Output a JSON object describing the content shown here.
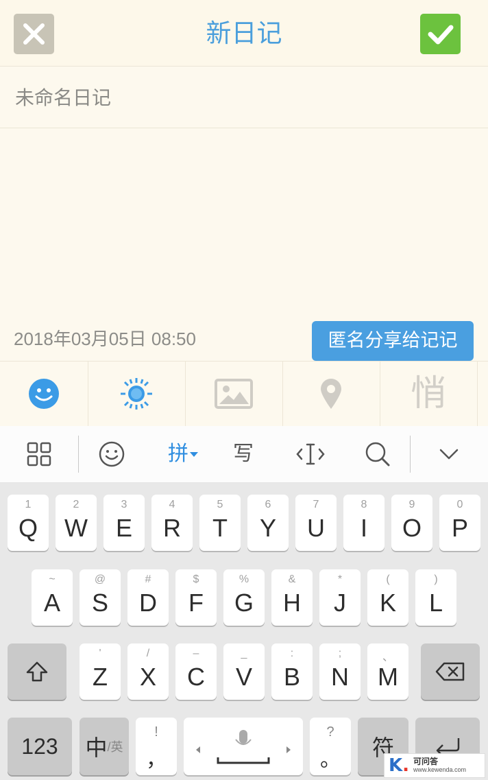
{
  "header": {
    "title": "新日记",
    "close_icon": "close-icon",
    "confirm_icon": "check-icon",
    "colors": {
      "title": "#4b9fdc",
      "close_bg": "#c8c4b6",
      "confirm_bg": "#6cc23e"
    }
  },
  "editor": {
    "title_placeholder": "未命名日记",
    "title_value": "",
    "datetime": "2018年03月05日 08:50"
  },
  "tooltip": {
    "text": "匿名分享给记记"
  },
  "toolbar": {
    "items": [
      {
        "icon": "emoji-icon",
        "active": true
      },
      {
        "icon": "weather-sun-icon",
        "active": true
      },
      {
        "icon": "image-icon",
        "active": false
      },
      {
        "icon": "location-pin-icon",
        "active": false
      },
      {
        "icon": "anonymous-icon",
        "label": "悄",
        "active": false
      }
    ],
    "active_color": "#3b9be6"
  },
  "ime_bar": {
    "items": [
      "grid-menu-icon",
      "emoji-icon",
      "pinyin-mode",
      "handwriting-mode",
      "cursor-edit-icon",
      "search-icon",
      "collapse-keyboard-icon"
    ],
    "pinyin_label": "拼",
    "write_label": "写"
  },
  "keyboard": {
    "row1": [
      {
        "main": "Q",
        "sub": "1"
      },
      {
        "main": "W",
        "sub": "2"
      },
      {
        "main": "E",
        "sub": "3"
      },
      {
        "main": "R",
        "sub": "4"
      },
      {
        "main": "T",
        "sub": "5"
      },
      {
        "main": "Y",
        "sub": "6"
      },
      {
        "main": "U",
        "sub": "7"
      },
      {
        "main": "I",
        "sub": "8"
      },
      {
        "main": "O",
        "sub": "9"
      },
      {
        "main": "P",
        "sub": "0"
      }
    ],
    "row2": [
      {
        "main": "A",
        "sub": "~"
      },
      {
        "main": "S",
        "sub": "@"
      },
      {
        "main": "D",
        "sub": "#"
      },
      {
        "main": "F",
        "sub": "$"
      },
      {
        "main": "G",
        "sub": "%"
      },
      {
        "main": "H",
        "sub": "&"
      },
      {
        "main": "J",
        "sub": "*"
      },
      {
        "main": "K",
        "sub": "("
      },
      {
        "main": "L",
        "sub": ")"
      }
    ],
    "row3": [
      {
        "main": "Z",
        "sub": "'"
      },
      {
        "main": "X",
        "sub": "/"
      },
      {
        "main": "C",
        "sub": "–"
      },
      {
        "main": "V",
        "sub": "_"
      },
      {
        "main": "B",
        "sub": ":"
      },
      {
        "main": "N",
        "sub": ";"
      },
      {
        "main": "M",
        "sub": "、"
      }
    ],
    "bottom": {
      "num_label": "123",
      "zh_label": "中",
      "en_label": "/英",
      "comma_sub": "!",
      "comma_main": "，",
      "period_sub": "?",
      "period_main": "。",
      "symbol_label": "符"
    }
  },
  "watermark": {
    "letter": "K",
    "name": "可问答",
    "url": "www.kewenda.com"
  }
}
